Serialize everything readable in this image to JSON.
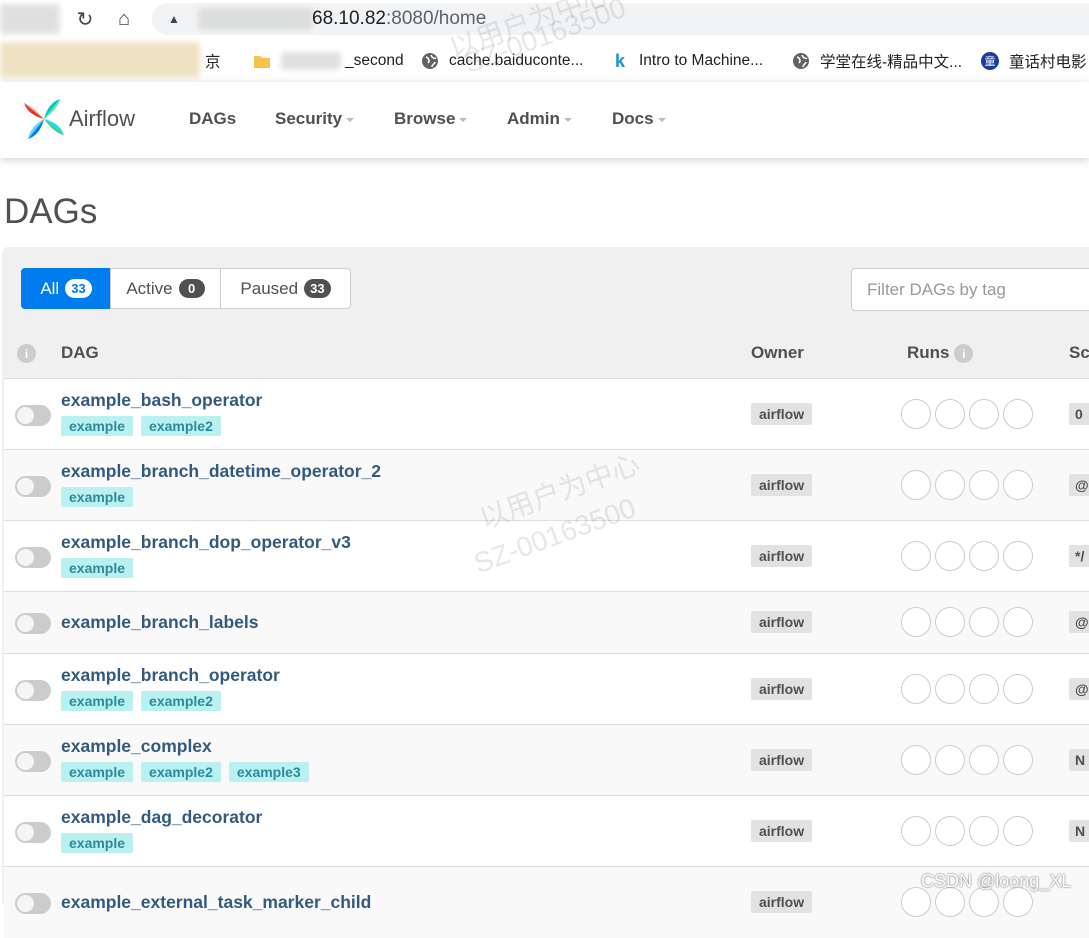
{
  "browser": {
    "url_host": "68.10.82",
    "url_rest": ":8080/home",
    "bookmarks": [
      {
        "label": "京",
        "icon": "blurred-icon"
      },
      {
        "label": "_second",
        "icon": "folder-icon"
      },
      {
        "label": "cache.baiduconte...",
        "icon": "globe-icon"
      },
      {
        "label": "Intro to Machine...",
        "icon": "k-logo-icon"
      },
      {
        "label": "学堂在线-精品中文...",
        "icon": "globe-icon"
      },
      {
        "label": "童话村电影",
        "icon": "tonghua-icon"
      }
    ]
  },
  "navbar": {
    "brand": "Airflow",
    "items": [
      {
        "label": "DAGs",
        "caret": false
      },
      {
        "label": "Security",
        "caret": true
      },
      {
        "label": "Browse",
        "caret": true
      },
      {
        "label": "Admin",
        "caret": true
      },
      {
        "label": "Docs",
        "caret": true
      }
    ]
  },
  "page_title": "DAGs",
  "filters": {
    "all": {
      "label": "All",
      "count": "33"
    },
    "active": {
      "label": "Active",
      "count": "0"
    },
    "paused": {
      "label": "Paused",
      "count": "33"
    },
    "tag_placeholder": "Filter DAGs by tag"
  },
  "table": {
    "headers": {
      "info": "i",
      "dag": "DAG",
      "owner": "Owner",
      "runs": "Runs",
      "schedule": "Sc"
    },
    "rows": [
      {
        "name": "example_bash_operator",
        "tags": [
          "example",
          "example2"
        ],
        "owner": "airflow",
        "schedule": "0"
      },
      {
        "name": "example_branch_datetime_operator_2",
        "tags": [
          "example"
        ],
        "owner": "airflow",
        "schedule": "@"
      },
      {
        "name": "example_branch_dop_operator_v3",
        "tags": [
          "example"
        ],
        "owner": "airflow",
        "schedule": "*/"
      },
      {
        "name": "example_branch_labels",
        "tags": [],
        "owner": "airflow",
        "schedule": "@"
      },
      {
        "name": "example_branch_operator",
        "tags": [
          "example",
          "example2"
        ],
        "owner": "airflow",
        "schedule": "@"
      },
      {
        "name": "example_complex",
        "tags": [
          "example",
          "example2",
          "example3"
        ],
        "owner": "airflow",
        "schedule": "N"
      },
      {
        "name": "example_dag_decorator",
        "tags": [
          "example"
        ],
        "owner": "airflow",
        "schedule": "N"
      },
      {
        "name": "example_external_task_marker_child",
        "tags": [],
        "owner": "airflow",
        "schedule": ""
      }
    ]
  },
  "watermark": {
    "line1": "以用户为中心",
    "line2": "SZ-00163500"
  },
  "credit": "CSDN @loong_XL"
}
